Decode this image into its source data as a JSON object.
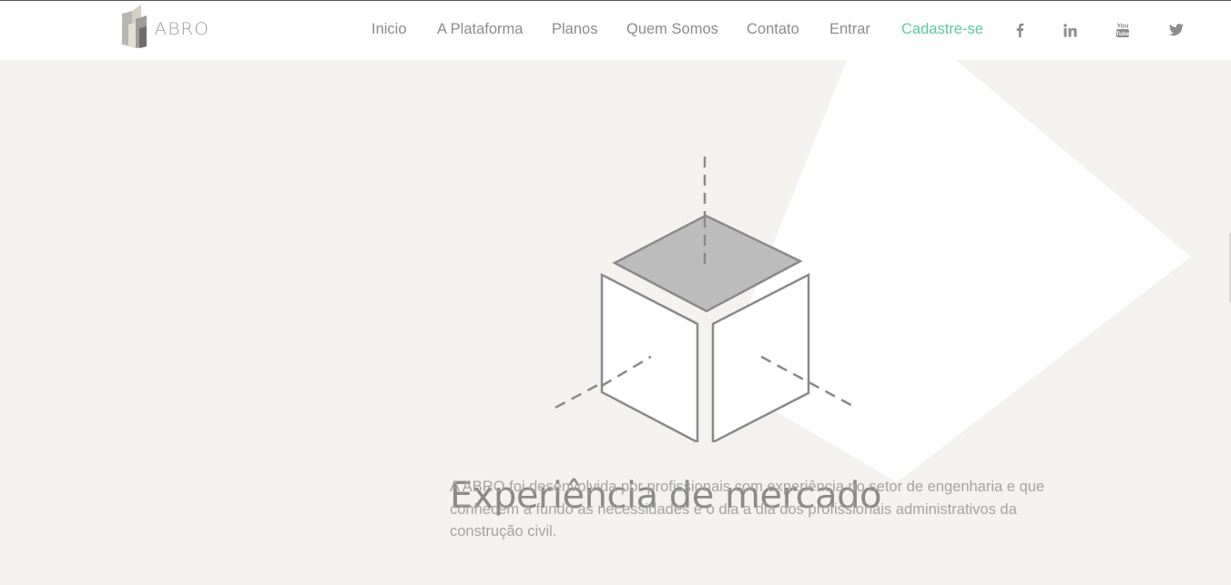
{
  "brand": {
    "name": "ABRO"
  },
  "nav": {
    "items": [
      {
        "label": "Inicio"
      },
      {
        "label": "A Plataforma"
      },
      {
        "label": "Planos"
      },
      {
        "label": "Quem Somos"
      },
      {
        "label": "Contato"
      },
      {
        "label": "Entrar"
      },
      {
        "label": "Cadastre-se"
      }
    ],
    "social": [
      {
        "icon": "facebook-icon"
      },
      {
        "icon": "linkedin-icon"
      },
      {
        "icon": "youtube-icon"
      },
      {
        "icon": "twitter-icon"
      }
    ]
  },
  "hero": {
    "title": "Experiência de mercado",
    "description": "A ABRO foi desenvolvida por profissionais com experiência no setor de engenharia e que conhecem a fundo as necessidades e o dia a dia dos profissionais administrativos da construção civil."
  },
  "colors": {
    "accent": "#5cc9a2",
    "nav_text": "#8c8c8c",
    "background": "#f3f2ef",
    "headline": "#8a8a8a"
  }
}
